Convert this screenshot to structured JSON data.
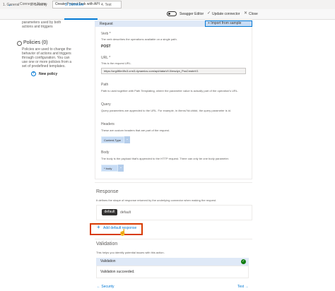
{
  "header": {
    "back_icon": "back-arrow-icon",
    "connector_name": "Connector Name",
    "title": "Create Project Task with API"
  },
  "tabs": [
    {
      "label": "1. General"
    },
    {
      "label": "2. Security"
    },
    {
      "label": "3. Definition"
    },
    {
      "label": "4. Test"
    }
  ],
  "actions": {
    "swagger_label": "Swagger Editor",
    "update_label": "Update connector",
    "close_label": "Close"
  },
  "left": {
    "intro_lines": [
      "parameters used by both",
      "actions and triggers"
    ],
    "policies_title": "Policies (0)",
    "policies_lines": [
      "Policies are used to change the",
      "behavior of actions and triggers",
      "through configuration. You can",
      "use one or more policies from a",
      "set of predefined templates."
    ],
    "new_policy": "New policy"
  },
  "request": {
    "title": "Request",
    "import_label": "+ Import from sample",
    "verb_label": "Verb *",
    "verb_desc": "The verb describes the operations available on a single path.",
    "verb_value": "POST",
    "url_label": "URL *",
    "url_desc": "This is the request URL.",
    "url_value": "https://org4f6e49c3.crm3.dynamics.com/api/data/v9.0/msdyn_PssCreateV1",
    "path_label": "Path",
    "path_desc": "Path is used together with Path Templating, where the parameter value is actually part of the operation's URL.",
    "query_label": "Query",
    "query_desc": "Query parameters are appended to the URL. For example, in /items?id=####, the query parameter is id.",
    "headers_label": "Headers",
    "headers_desc": "These are custom headers that are part of the request.",
    "headers_chip": "Content-Type",
    "body_label": "Body",
    "body_desc": "The body is the payload that's appended to the HTTP request. There can only be one body parameter.",
    "body_chip": "* body"
  },
  "response": {
    "title": "Response",
    "desc": "It defines the shape of response returned by the underlying connector when making the request.",
    "chip": "default",
    "chip_desc": "default",
    "add_label": "Add default response"
  },
  "validation": {
    "title": "Validation",
    "desc": "This helps you identify potential issues with this action.",
    "head": "Validation",
    "result": "Validation succeeded."
  },
  "footer": {
    "prev_label": "← Security",
    "next_label": "Test →"
  }
}
